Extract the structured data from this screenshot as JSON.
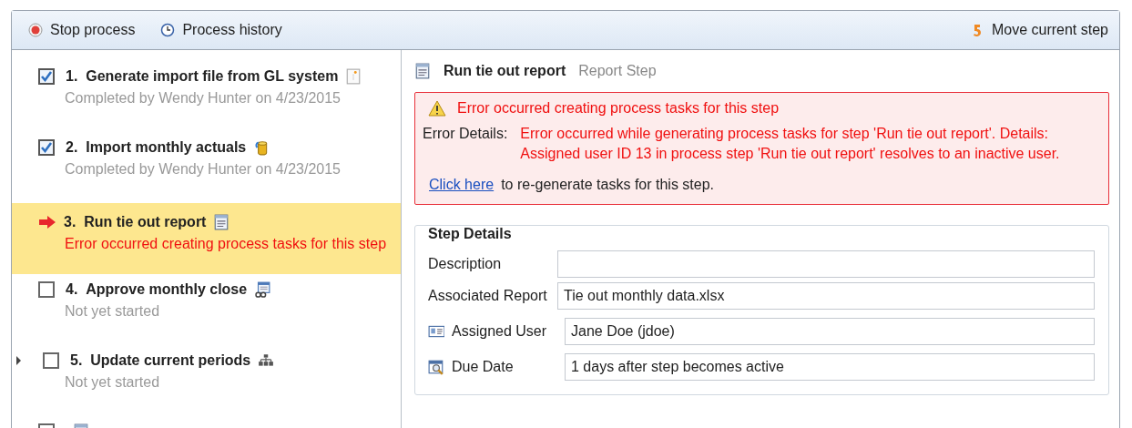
{
  "toolbar": {
    "left": [
      {
        "label": "Stop process"
      },
      {
        "label": "Process history"
      }
    ],
    "right": [
      {
        "label": "Move current step"
      }
    ]
  },
  "steps": [
    {
      "number": "1.",
      "title": "Generate import file from GL system",
      "kind": "document",
      "checked": true,
      "selected": false,
      "expandable": false,
      "status": "Completed by Wendy Hunter on 4/23/2015",
      "error": false
    },
    {
      "number": "2.",
      "title": "Import monthly actuals",
      "kind": "database",
      "checked": true,
      "selected": false,
      "expandable": false,
      "status": "Completed by Wendy Hunter on 4/23/2015",
      "error": false
    },
    {
      "number": "3.",
      "title": "Run tie out report",
      "kind": "report",
      "checked": false,
      "selected": true,
      "expandable": false,
      "status": "Error occurred creating process tasks for this step",
      "error": true
    },
    {
      "number": "4.",
      "title": "Approve monthly close",
      "kind": "approval",
      "checked": false,
      "selected": false,
      "expandable": false,
      "status": "Not yet started",
      "error": false
    },
    {
      "number": "5.",
      "title": "Update current periods",
      "kind": "hierarchy",
      "checked": false,
      "selected": false,
      "expandable": true,
      "status": "Not yet started",
      "error": false
    },
    {
      "kind": "report",
      "checked": false,
      "selected": false,
      "expandable": false
    }
  ],
  "detail": {
    "title": "Run tie out report",
    "type": "Report Step",
    "error": {
      "heading": "Error occurred creating process tasks for this step",
      "details_label": "Error Details:",
      "details_lines": [
        "Error occurred while generating process tasks for step 'Run tie out report'.  Details:",
        "Assigned user ID 13 in process step 'Run tie out report' resolves to an inactive user."
      ],
      "link": "Click here",
      "link_suffix": "to re-generate tasks for this step."
    },
    "step_details": {
      "legend": "Step Details",
      "fields": [
        {
          "label": "Description"
        },
        {
          "label": "Associated Report",
          "value": "Tie out monthly data.xlsx"
        },
        {
          "label": "Assigned User",
          "value": "Jane Doe (jdoe)",
          "kind": "user-card"
        },
        {
          "label": "Due Date",
          "value": "1 days after step becomes active",
          "kind": "calendar"
        }
      ]
    }
  }
}
